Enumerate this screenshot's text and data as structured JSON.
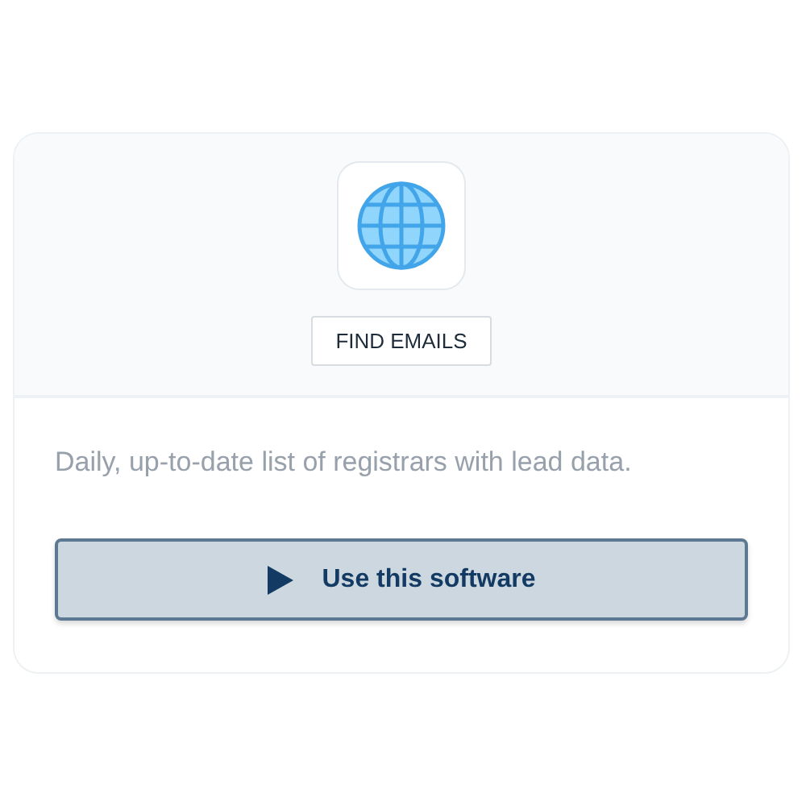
{
  "card": {
    "tag": "FIND EMAILS",
    "description": "Daily, up-to-date list of registrars with lead data.",
    "action": "Use this software"
  }
}
